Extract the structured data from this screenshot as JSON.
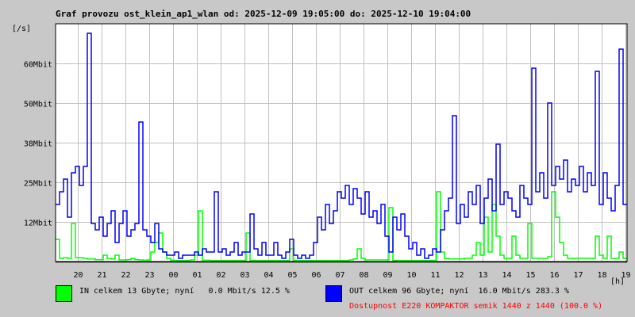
{
  "header": {
    "title": "Graf provozu ost_klein_ap1_wlan od: 2025-12-09 19:05:00 do: 2025-12-10 19:04:00",
    "y_unit": "[/s]",
    "x_unit": "[h]"
  },
  "legend": {
    "in_label": "IN celkem 13 Gbyte; nyní   0.0 Mbit/s 12.5 %",
    "out_label": "OUT celkem 96 Gbyte; nyní  16.0 Mbit/s 283.3 %",
    "availability": "Dostupnost E220 KOMPAKTOR semik 1440 z 1440 (100.0 %)"
  },
  "colors": {
    "in": "#00ff00",
    "out": "#0000ff",
    "availability": "#ff0000",
    "grid": "#c0c0c0",
    "background": "#c8c8c8"
  },
  "chart_data": {
    "type": "line",
    "title": "Graf provozu ost_klein_ap1_wlan od: 2025-12-09 19:05:00 do: 2025-12-10 19:04:00",
    "xlabel": "[h]",
    "ylabel": "[/s]",
    "x_ticks": [
      "20",
      "21",
      "22",
      "23",
      "00",
      "01",
      "02",
      "03",
      "04",
      "05",
      "06",
      "07",
      "08",
      "09",
      "10",
      "11",
      "12",
      "13",
      "14",
      "15",
      "16",
      "17",
      "18",
      "19"
    ],
    "y_ticks": [
      {
        "value": 12.5,
        "label": "12Mbit"
      },
      {
        "value": 25,
        "label": "25Mbit"
      },
      {
        "value": 37.5,
        "label": "38Mbit"
      },
      {
        "value": 50,
        "label": "50Mbit"
      },
      {
        "value": 62.5,
        "label": "60Mbit"
      }
    ],
    "ylim": [
      0,
      75
    ],
    "x_step_minutes": 10,
    "grid": true,
    "series": [
      {
        "name": "IN",
        "color": "#00ff00",
        "unit": "Mbit/s",
        "values": [
          7,
          1,
          1.2,
          1,
          12,
          1.2,
          1.2,
          1,
          0.8,
          0.8,
          0.6,
          0.6,
          2,
          1,
          0.8,
          2,
          0.5,
          0.5,
          0.6,
          1,
          0.6,
          0.5,
          0.4,
          0.5,
          3,
          6,
          9,
          3,
          1,
          0.4,
          0.3,
          0.3,
          0.3,
          0.3,
          0.5,
          2,
          16,
          0.4,
          0.4,
          0.3,
          0.3,
          0.3,
          0.3,
          0.3,
          0.3,
          0.3,
          0.3,
          0.3,
          9,
          0.3,
          0.3,
          0.3,
          0.3,
          0.3,
          0.3,
          0.3,
          0.3,
          0.3,
          0.3,
          4,
          0.3,
          0.3,
          0.3,
          0.3,
          0.3,
          0.3,
          0.3,
          0.3,
          0.3,
          0.3,
          0.3,
          0.3,
          0.3,
          0.3,
          0.5,
          0.8,
          4,
          1,
          0.5,
          0.5,
          0.5,
          0.5,
          0.5,
          0.5,
          17,
          0.3,
          0.3,
          0.3,
          0.3,
          0.3,
          0.3,
          0.3,
          0.3,
          0.3,
          0.3,
          0.3,
          22,
          3,
          1,
          0.8,
          0.8,
          0.8,
          0.8,
          1,
          1,
          2,
          6,
          2,
          14,
          3,
          18,
          8,
          2,
          1,
          1,
          8,
          2,
          1,
          1,
          12,
          1,
          1,
          1,
          1,
          1.5,
          22,
          14,
          6,
          2,
          1,
          1,
          1,
          1,
          1,
          1,
          1,
          8,
          2,
          1,
          8,
          1,
          1,
          3,
          1
        ]
      },
      {
        "name": "OUT",
        "color": "#0000ff",
        "unit": "Mbit/s",
        "values": [
          18,
          22,
          26,
          14,
          28,
          30,
          24,
          30,
          72,
          12,
          10,
          14,
          8,
          12,
          16,
          6,
          12,
          16,
          8,
          10,
          12,
          44,
          10,
          8,
          6,
          12,
          4,
          3,
          2,
          2,
          3,
          1,
          2,
          2,
          2,
          3,
          2,
          4,
          3,
          3,
          22,
          3,
          4,
          2,
          3,
          6,
          2,
          3,
          3,
          15,
          4,
          2,
          6,
          2,
          2,
          6,
          2,
          1,
          3,
          7,
          2,
          1,
          2,
          1,
          2,
          6,
          14,
          10,
          18,
          12,
          16,
          22,
          20,
          24,
          18,
          23,
          20,
          15,
          22,
          14,
          16,
          12,
          18,
          8,
          3,
          14,
          10,
          15,
          8,
          4,
          6,
          2,
          4,
          1,
          2,
          4,
          3,
          10,
          16,
          20,
          46,
          12,
          18,
          14,
          22,
          18,
          24,
          12,
          20,
          26,
          16,
          37,
          18,
          22,
          20,
          16,
          14,
          24,
          20,
          18,
          61,
          22,
          28,
          20,
          50,
          24,
          30,
          26,
          32,
          22,
          26,
          24,
          30,
          22,
          28,
          24,
          60,
          18,
          28,
          20,
          16,
          24,
          67,
          18
        ]
      }
    ]
  }
}
